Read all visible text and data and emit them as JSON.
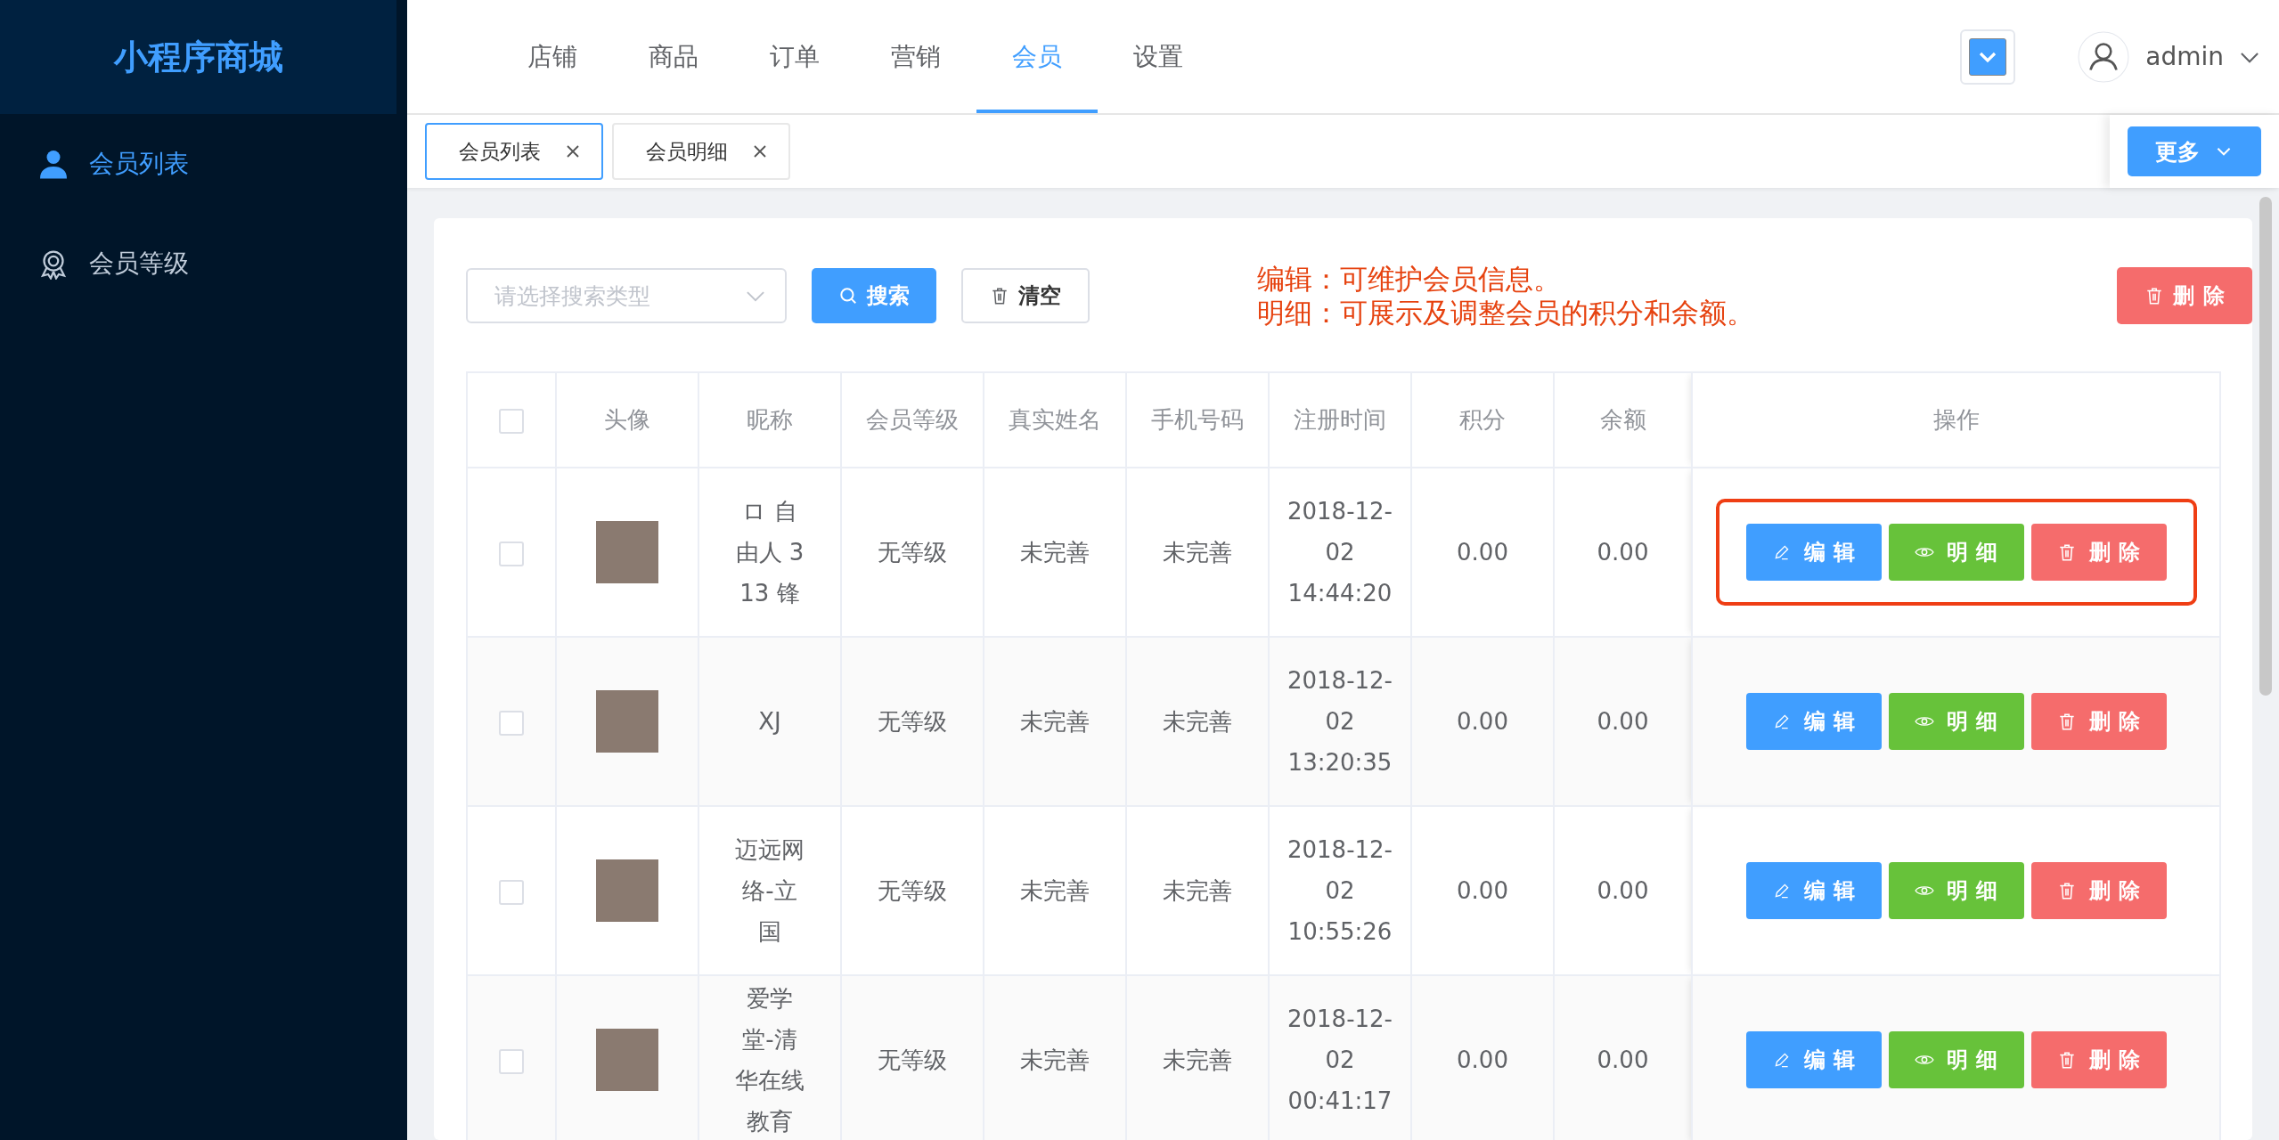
{
  "sidebar": {
    "logo": "小程序商城",
    "items": [
      {
        "label": "会员列表",
        "kind": "user",
        "selected": true
      },
      {
        "label": "会员等级",
        "kind": "badge",
        "selected": false
      }
    ]
  },
  "top_nav": {
    "tabs": [
      {
        "label": "店铺",
        "selected": false
      },
      {
        "label": "商品",
        "selected": false
      },
      {
        "label": "订单",
        "selected": false
      },
      {
        "label": "营销",
        "selected": false
      },
      {
        "label": "会员",
        "selected": true
      },
      {
        "label": "设置",
        "selected": false
      }
    ],
    "user": "admin"
  },
  "page_tabs": [
    {
      "label": "会员列表",
      "selected": true
    },
    {
      "label": "会员明细",
      "selected": false
    }
  ],
  "more_button": "更多",
  "toolbar": {
    "select_placeholder": "请选择搜索类型",
    "search_button": "搜索",
    "clear_button": "清空",
    "delete_button": "删除"
  },
  "note_lines": [
    "编辑：可维护会员信息。",
    "明细：可展示及调整会员的积分和余额。"
  ],
  "table": {
    "all_checked": false,
    "columns": [
      "头像",
      "昵称",
      "会员等级",
      "真实姓名",
      "手机号码",
      "注册时间",
      "积分",
      "余额",
      "操作"
    ],
    "rows": [
      {
        "checked": false,
        "highlighted": true,
        "nickname": "ロ 自由人 313 锋",
        "level": "无等级",
        "real_name": "未完善",
        "phone": "未完善",
        "registered": "2018-12-02 14:44:20",
        "points": "0.00",
        "balance": "0.00",
        "actions": [
          {
            "kind": "edit",
            "label": "编辑"
          },
          {
            "kind": "detail",
            "label": "明细"
          },
          {
            "kind": "delete",
            "label": "删除"
          }
        ]
      },
      {
        "checked": false,
        "highlighted": false,
        "nickname": "XJ",
        "level": "无等级",
        "real_name": "未完善",
        "phone": "未完善",
        "registered": "2018-12-02 13:20:35",
        "points": "0.00",
        "balance": "0.00",
        "actions": [
          {
            "kind": "edit",
            "label": "编辑"
          },
          {
            "kind": "detail",
            "label": "明细"
          },
          {
            "kind": "delete",
            "label": "删除"
          }
        ]
      },
      {
        "checked": false,
        "highlighted": false,
        "nickname": "迈远网络-立国",
        "level": "无等级",
        "real_name": "未完善",
        "phone": "未完善",
        "registered": "2018-12-02 10:55:26",
        "points": "0.00",
        "balance": "0.00",
        "actions": [
          {
            "kind": "edit",
            "label": "编辑"
          },
          {
            "kind": "detail",
            "label": "明细"
          },
          {
            "kind": "delete",
            "label": "删除"
          }
        ]
      },
      {
        "checked": false,
        "highlighted": false,
        "nickname": "爱学堂-清华在线教育",
        "level": "无等级",
        "real_name": "未完善",
        "phone": "未完善",
        "registered": "2018-12-02 00:41:17",
        "points": "0.00",
        "balance": "0.00",
        "actions": [
          {
            "kind": "edit",
            "label": "编辑"
          },
          {
            "kind": "detail",
            "label": "明细"
          },
          {
            "kind": "delete",
            "label": "删除"
          }
        ]
      }
    ]
  }
}
